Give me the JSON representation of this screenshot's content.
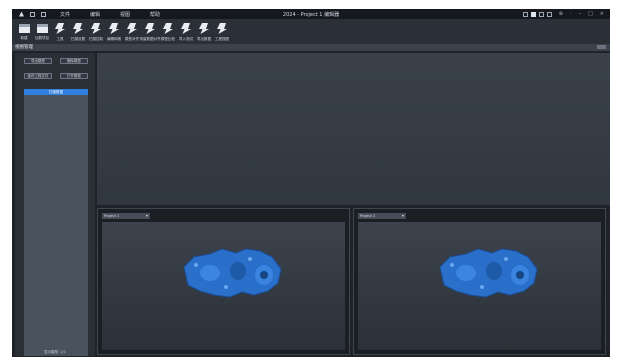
{
  "window": {
    "title": "2024 - Project 1 编辑器",
    "menu": [
      "文件",
      "编辑",
      "视图",
      "帮助"
    ],
    "window_controls": [
      "⊕",
      "·",
      "–",
      "□",
      "×"
    ]
  },
  "toolbar": {
    "tools": [
      {
        "label": "新建",
        "icon": "new-icon"
      },
      {
        "label": "加载项目",
        "icon": "open-icon"
      },
      {
        "label": "工具",
        "icon": "tool-icon"
      },
      {
        "label": "扫描设置",
        "icon": "scan-settings-icon"
      },
      {
        "label": "扫描控制",
        "icon": "scan-control-icon"
      },
      {
        "label": "编辑网格",
        "icon": "edit-mesh-icon"
      },
      {
        "label": "模型对齐",
        "icon": "align-icon"
      },
      {
        "label": "测量数据对齐",
        "icon": "measure-align-icon"
      },
      {
        "label": "模型比较",
        "icon": "compare-icon"
      },
      {
        "label": "导入测试",
        "icon": "import-icon"
      },
      {
        "label": "导出数据",
        "icon": "export-icon"
      },
      {
        "label": "工程视图",
        "icon": "project-view-icon"
      }
    ]
  },
  "panel": {
    "title": "视图管理"
  },
  "sidebar": {
    "buttons": [
      "导出模型",
      "删除模型",
      "保存工程文件",
      "打开模型"
    ],
    "list": [
      "扫描数据"
    ],
    "footer": "显示模型: 1/1"
  },
  "panes": [
    {
      "dropdown": "Project 1"
    },
    {
      "dropdown": "Project 2"
    }
  ],
  "colors": {
    "accent": "#2f7fe0",
    "model": "#2a6fc9",
    "background": "#1f2329"
  }
}
